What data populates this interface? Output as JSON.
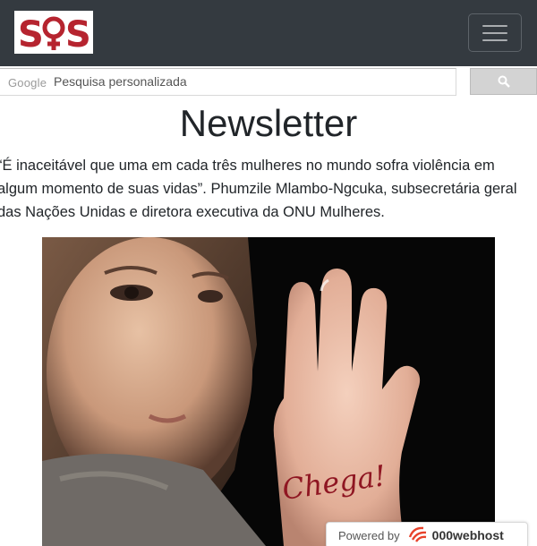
{
  "brand": {
    "logo_text": "SOS",
    "color": "#b6242f"
  },
  "navbar": {
    "background": "#343a40",
    "menu_icon": "hamburger-icon"
  },
  "search": {
    "google_label": "Google",
    "placeholder": "Pesquisa personalizada",
    "button_icon": "search-icon"
  },
  "page": {
    "title": "Newsletter",
    "quote": "“É inaceitável que uma em cada três mulheres no mundo sofra violência em algum momento de suas vidas”. Phumzile Mlambo-Ngcuka, subsecretária geral das Nações Unidas e diretora executiva da ONU Mulheres."
  },
  "image": {
    "hand_text": "Chega!"
  },
  "hosting_badge": {
    "powered_label": "Powered by",
    "host_name": "000webhost",
    "icon": "000webhost-logo-icon"
  }
}
